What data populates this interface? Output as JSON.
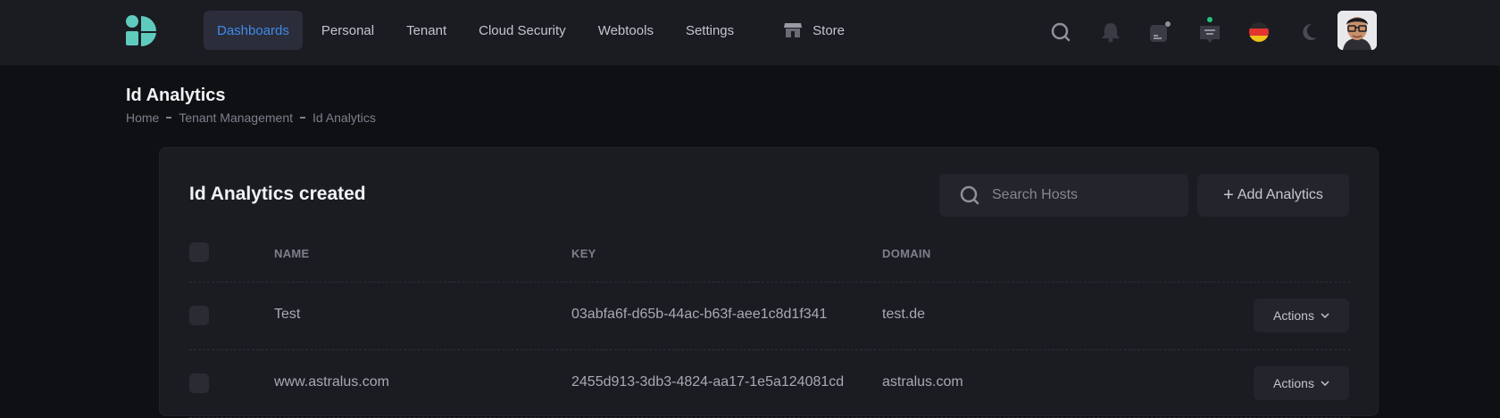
{
  "nav": {
    "items": [
      {
        "label": "Dashboards",
        "active": true
      },
      {
        "label": "Personal"
      },
      {
        "label": "Tenant"
      },
      {
        "label": "Cloud Security"
      },
      {
        "label": "Webtools"
      },
      {
        "label": "Settings"
      }
    ],
    "store_label": "Store"
  },
  "icons": {
    "logo": "app-logo",
    "search": "search-icon",
    "notifications": "bell-icon",
    "activity": "activity-icon",
    "chat": "chat-icon",
    "language": "german-flag-icon",
    "theme": "moon-icon",
    "store": "store-icon"
  },
  "colors": {
    "accent": "#3e8be8",
    "logo": "#5fcbbf",
    "status_dot": "#1fc77a",
    "background": "#0f1014",
    "surface": "#1b1c22"
  },
  "page": {
    "title": "Id Analytics",
    "breadcrumb": [
      "Home",
      "Tenant Management",
      "Id Analytics"
    ]
  },
  "card": {
    "title": "Id Analytics created",
    "search_placeholder": "Search Hosts",
    "add_label": "Add Analytics",
    "columns": [
      "NAME",
      "KEY",
      "DOMAIN"
    ],
    "rows": [
      {
        "name": "Test",
        "key": "03abfa6f-d65b-44ac-b63f-aee1c8d1f341",
        "domain": "test.de",
        "action": "Actions"
      },
      {
        "name": "www.astralus.com",
        "key": "2455d913-3db3-4824-aa17-1e5a124081cd",
        "domain": "astralus.com",
        "action": "Actions"
      }
    ]
  }
}
